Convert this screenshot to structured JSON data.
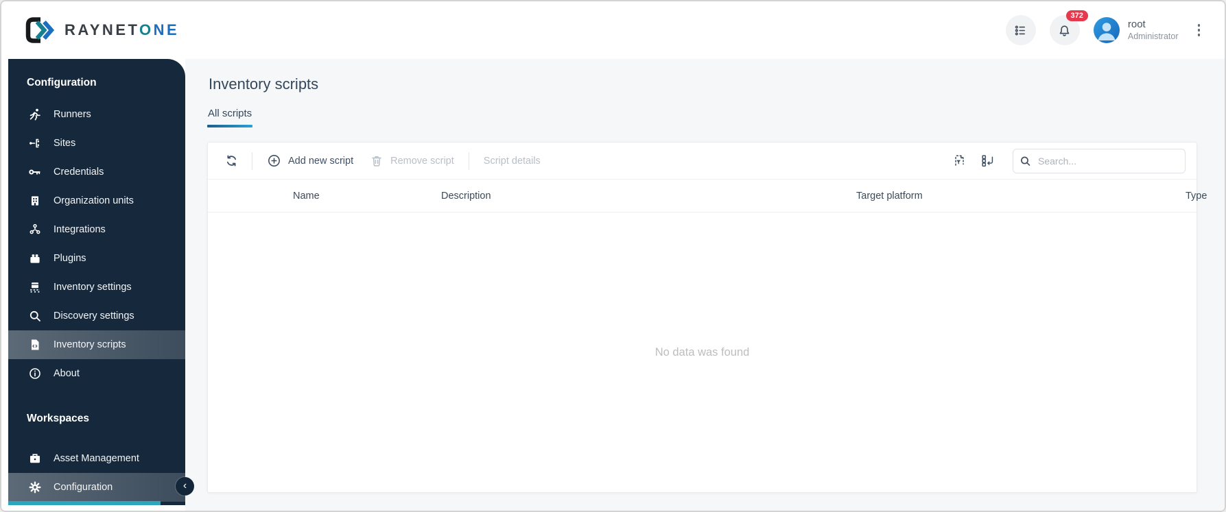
{
  "brand": {
    "logo_text_primary": "RAYNET",
    "logo_text_o": "O",
    "logo_text_ne": "NE"
  },
  "topbar": {
    "notifications": {
      "count": "372"
    },
    "user": {
      "name": "root",
      "role": "Administrator"
    }
  },
  "sidebar": {
    "sections": [
      {
        "heading": "Configuration",
        "items": [
          {
            "label": "Runners",
            "icon": "runner-icon"
          },
          {
            "label": "Sites",
            "icon": "sites-icon"
          },
          {
            "label": "Credentials",
            "icon": "key-icon"
          },
          {
            "label": "Organization units",
            "icon": "building-icon"
          },
          {
            "label": "Integrations",
            "icon": "integrations-icon"
          },
          {
            "label": "Plugins",
            "icon": "plugin-icon"
          },
          {
            "label": "Inventory settings",
            "icon": "conveyor-icon"
          },
          {
            "label": "Discovery settings",
            "icon": "magnifier-icon"
          },
          {
            "label": "Inventory scripts",
            "icon": "script-file-icon",
            "selected": true
          },
          {
            "label": "About",
            "icon": "info-icon"
          }
        ]
      },
      {
        "heading": "Workspaces",
        "items": [
          {
            "label": "Asset Management",
            "icon": "briefcase-icon"
          },
          {
            "label": "Configuration",
            "icon": "gear-icon",
            "selected": true
          }
        ]
      }
    ]
  },
  "page": {
    "title": "Inventory scripts"
  },
  "tabs": [
    {
      "label": "All scripts",
      "active": true
    }
  ],
  "toolbar": {
    "add_label": "Add new script",
    "remove_label": "Remove script",
    "details_label": "Script details",
    "search_placeholder": "Search..."
  },
  "table": {
    "columns": [
      "Name",
      "Description",
      "Target platform",
      "Type"
    ],
    "rows": [],
    "empty_message": "No data was found"
  },
  "colors": {
    "sidebar_bg": "#16293C",
    "selected_item_overlay": "rgba(255,255,255,0.25)",
    "accent_blue": "#2D9FD8",
    "badge_red": "#E5394E",
    "logo_teal": "#15808F",
    "logo_blue": "#1C6FBF",
    "teal_strip": "#2CA6BC",
    "disabled_text": "#B9BFC7"
  }
}
